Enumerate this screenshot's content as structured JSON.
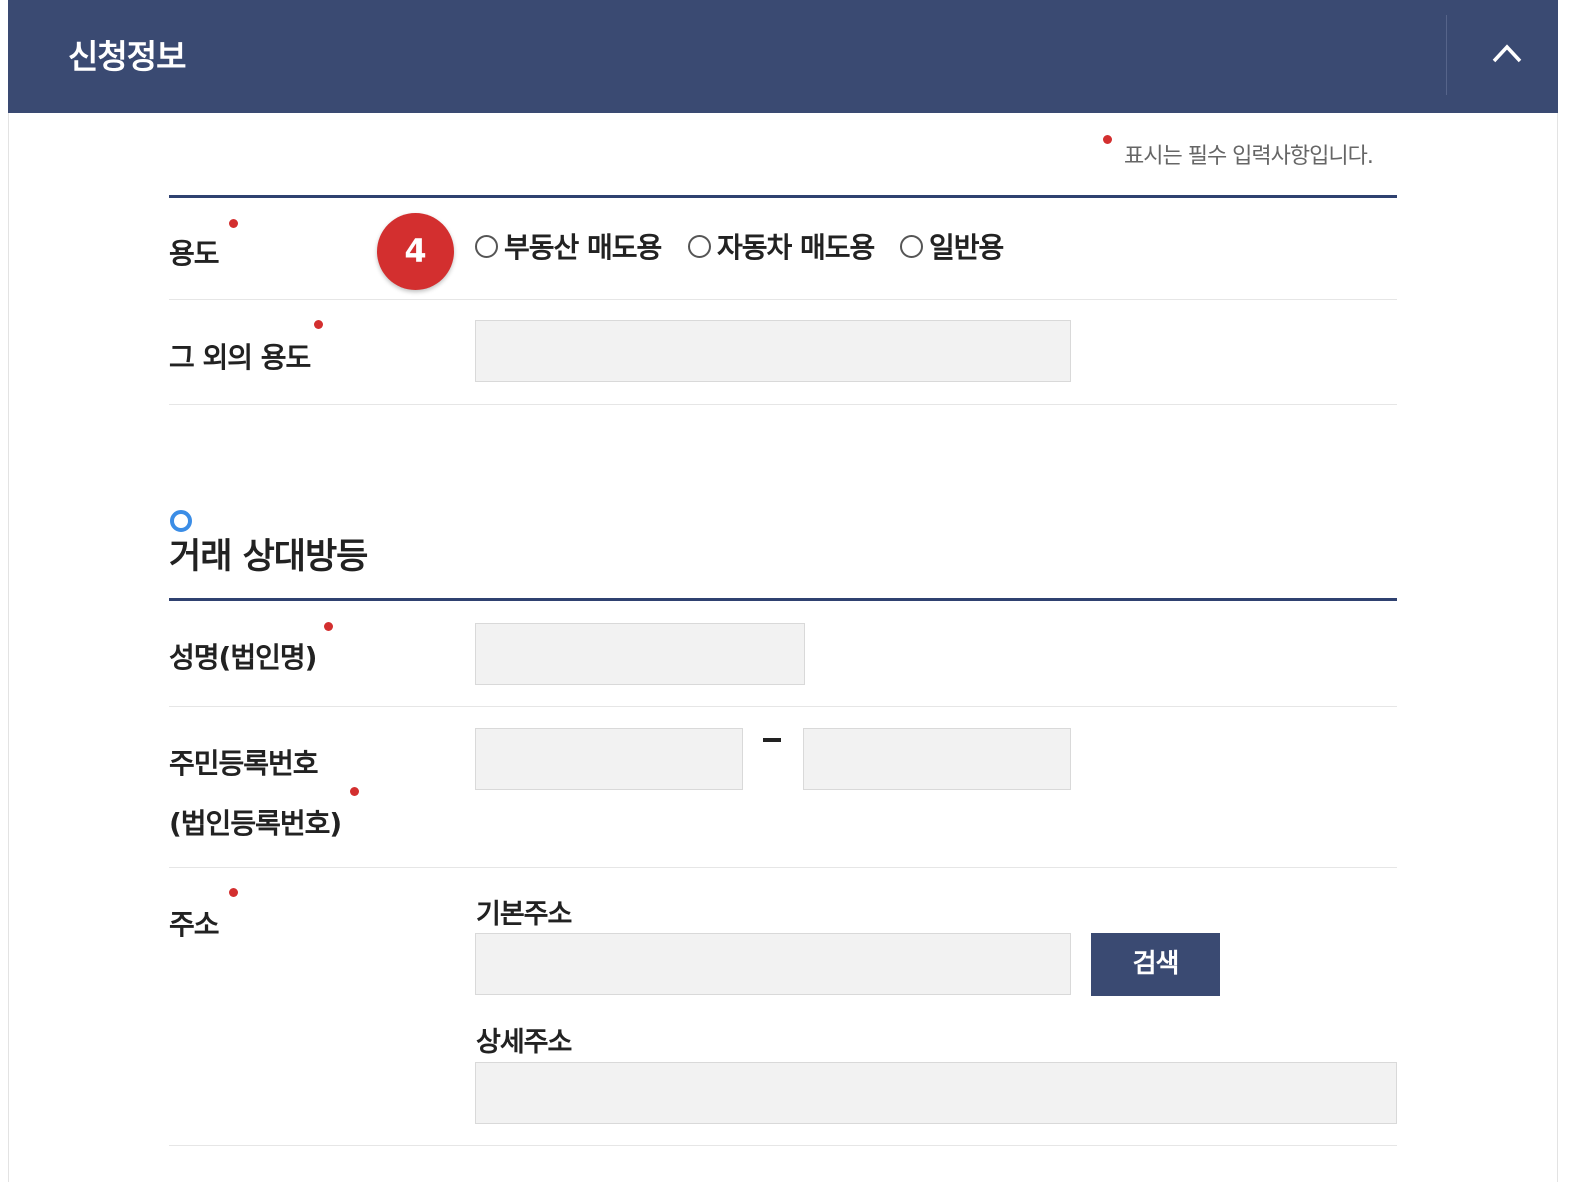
{
  "header": {
    "title": "신청정보"
  },
  "notice": {
    "text": "표시는 필수 입력사항입니다."
  },
  "usage": {
    "label": "용도",
    "step_badge": "4",
    "options": [
      {
        "label": "부동산 매도용",
        "selected": false
      },
      {
        "label": "자동차 매도용",
        "selected": false
      },
      {
        "label": "일반용",
        "selected": false
      }
    ]
  },
  "other_usage": {
    "label": "그 외의 용도",
    "value": ""
  },
  "counterparty": {
    "section_title": "거래 상대방등",
    "name": {
      "label": "성명(법인명)",
      "value": ""
    },
    "resident_number": {
      "label_line1": "주민등록번호",
      "label_line2": "(법인등록번호)",
      "part1": "",
      "separator": "-",
      "part2": ""
    },
    "address": {
      "label": "주소",
      "basic_label": "기본주소",
      "basic_value": "",
      "search_button": "검색",
      "detail_label": "상세주소",
      "detail_value": ""
    }
  },
  "colors": {
    "header_bg": "#3a4a72",
    "required_dot": "#d32f2f",
    "badge": "#d32f2f",
    "section_ring": "#3b8de6",
    "input_bg": "#f2f2f2"
  }
}
